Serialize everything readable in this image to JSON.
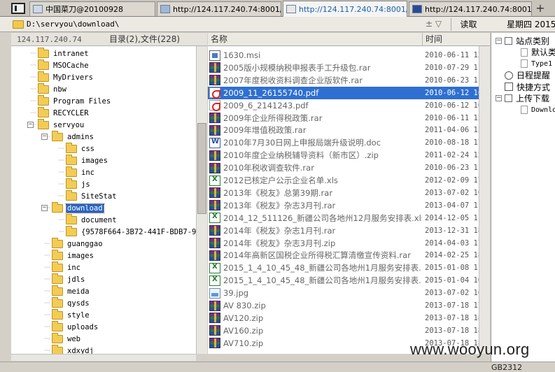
{
  "tabs": [
    {
      "label": "中国菜刀@20100928",
      "active": false
    },
    {
      "label": "http://124.117.240.74:8001/...",
      "active": false
    },
    {
      "label": "http://124.117.240.74:8001/...",
      "active": true
    },
    {
      "label": "http://124.117.240.74:8001/...",
      "active": false
    }
  ],
  "new_tab_label": "+",
  "address": {
    "path": "D:\\servyou\\download\\",
    "arrows": "± ▽",
    "read_label": "读取",
    "date": "星期四 2015"
  },
  "left_header": {
    "host": "124.117.240.74",
    "counts": "目录(2),文件(228)"
  },
  "tree": [
    {
      "label": "intranet",
      "depth": 1
    },
    {
      "label": "MSOCache",
      "depth": 1
    },
    {
      "label": "MyDrivers",
      "depth": 1
    },
    {
      "label": "nbw",
      "depth": 1
    },
    {
      "label": "Program Files",
      "depth": 1
    },
    {
      "label": "RECYCLER",
      "depth": 1
    },
    {
      "label": "servyou",
      "depth": 1,
      "toggle": "−"
    },
    {
      "label": "admins",
      "depth": 2,
      "toggle": "−"
    },
    {
      "label": "css",
      "depth": 3
    },
    {
      "label": "images",
      "depth": 3
    },
    {
      "label": "inc",
      "depth": 3
    },
    {
      "label": "js",
      "depth": 3
    },
    {
      "label": "SiteStat",
      "depth": 3
    },
    {
      "label": "download",
      "depth": 2,
      "toggle": "−",
      "selected": true
    },
    {
      "label": "document",
      "depth": 3
    },
    {
      "label": "{9578F664-3B72-441F-BDB7-94C",
      "depth": 3
    },
    {
      "label": "guanggao",
      "depth": 2
    },
    {
      "label": "images",
      "depth": 2
    },
    {
      "label": "inc",
      "depth": 2
    },
    {
      "label": "jdls",
      "depth": 2
    },
    {
      "label": "meida",
      "depth": 2
    },
    {
      "label": "qysds",
      "depth": 2
    },
    {
      "label": "style",
      "depth": 2
    },
    {
      "label": "uploads",
      "depth": 2
    },
    {
      "label": "web",
      "depth": 2
    },
    {
      "label": "xdxydj",
      "depth": 2
    }
  ],
  "list_header": {
    "name": "名称",
    "time": "时间"
  },
  "files": [
    {
      "name": "1630.msi",
      "time": "2010-06-11 13:1",
      "type": "msi"
    },
    {
      "name": "2005版小规模纳税申报表手工升级包.rar",
      "time": "2010-07-29 11:4",
      "type": "rar"
    },
    {
      "name": "2007年度税收资料调查企业版软件.rar",
      "time": "2010-06-23 11:0",
      "type": "rar"
    },
    {
      "name": "2009_11_26155740.pdf",
      "time": "2010-06-12 16:1",
      "type": "pdf",
      "selected": true
    },
    {
      "name": "2009_6_2141243.pdf",
      "time": "2010-06-12 16:2",
      "type": "pdf"
    },
    {
      "name": "2009年企业所得税政策.rar",
      "time": "2010-06-11 12:5",
      "type": "rar"
    },
    {
      "name": "2009年增值税政策.rar",
      "time": "2011-04-06 15:4",
      "type": "rar"
    },
    {
      "name": "2010年7月30日网上申报局端升级说明.doc",
      "time": "2010-08-18 17:5",
      "type": "doc"
    },
    {
      "name": "2010年度企业纳税辅导资料（新市区）.zip",
      "time": "2011-02-24 12:5",
      "type": "rar"
    },
    {
      "name": "2010年税收调查软件.rar",
      "time": "2010-06-23 11:2",
      "type": "rar"
    },
    {
      "name": "2012已核定户公示企业名单.xls",
      "time": "2012-02-09 17:1",
      "type": "xls"
    },
    {
      "name": "2013年《税友》总第39期.rar",
      "time": "2013-07-02 10:1",
      "type": "rar"
    },
    {
      "name": "2013年《税友》杂志3月刊.rar",
      "time": "2013-04-07 11:4",
      "type": "rar"
    },
    {
      "name": "2014_12_511126_新疆公司各地州12月服务安排表.xls",
      "time": "2014-12-05 11:0",
      "type": "xls"
    },
    {
      "name": "2014年《税友》杂志1月刊.rar",
      "time": "2013-12-31 18:2",
      "type": "rar"
    },
    {
      "name": "2014年《税友》杂志3月刊.zip",
      "time": "2014-04-03 17:5",
      "type": "rar"
    },
    {
      "name": "2014年高新区国税企业所得税汇算清缴宣传资料.rar",
      "time": "2014-02-25 18:0",
      "type": "rar"
    },
    {
      "name": "2015_1_4_10_45_48_新疆公司各地州1月服务安排表...",
      "time": "2015-01-08 11:3",
      "type": "xls"
    },
    {
      "name": "2015_1_4_10_45_48_新疆公司各地州1月服务安排表...",
      "time": "2015-01-04 10:5",
      "type": "xls"
    },
    {
      "name": "39.jpg",
      "time": "2013-07-02 10:5",
      "type": "jpg"
    },
    {
      "name": "AV 830.zip",
      "time": "2013-07-18 17:5",
      "type": "rar"
    },
    {
      "name": "AV120.zip",
      "time": "2013-07-18 18:0",
      "type": "rar"
    },
    {
      "name": "AV160.zip",
      "time": "2013-07-18 18:0",
      "type": "rar"
    },
    {
      "name": "AV710.zip",
      "time": "2013-07-18 18:0",
      "type": "rar"
    }
  ],
  "right_panel": [
    {
      "label": "站点类别",
      "depth": 0,
      "toggle": "−",
      "icon": "box"
    },
    {
      "label": "默认类",
      "depth": 1,
      "icon": "page"
    },
    {
      "label": "Type1",
      "depth": 1,
      "icon": "page",
      "small": true
    },
    {
      "label": "日程提醒",
      "depth": 0,
      "icon": "clock"
    },
    {
      "label": "快捷方式",
      "depth": 0,
      "icon": "link"
    },
    {
      "label": "上传下载",
      "depth": 0,
      "toggle": "−",
      "icon": "box"
    },
    {
      "label": "Downlo",
      "depth": 1,
      "icon": "page",
      "small": true
    }
  ],
  "status": {
    "encoding": "GB2312"
  },
  "watermark": "www.wooyun.org"
}
